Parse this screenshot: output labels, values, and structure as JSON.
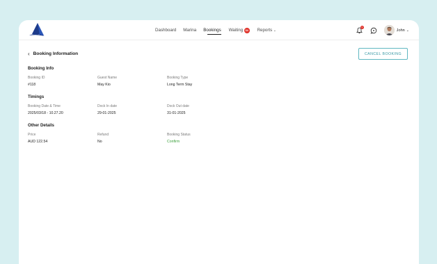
{
  "nav": {
    "items": [
      {
        "label": "Dashboard"
      },
      {
        "label": "Marina"
      },
      {
        "label": "Bookings"
      },
      {
        "label": "Waiting",
        "badge": "34"
      },
      {
        "label": "Reports"
      }
    ]
  },
  "header": {
    "bell_badge": "1",
    "user_name": "John"
  },
  "page": {
    "title": "Booking Information",
    "cancel_button": "CANCEL BOOKING"
  },
  "booking_info": {
    "title": "Booking Info",
    "fields": [
      {
        "label": "Booking ID",
        "value": "#118"
      },
      {
        "label": "Guest Name",
        "value": "May Kio"
      },
      {
        "label": "Booking Type",
        "value": "Long Term Stay"
      }
    ]
  },
  "timings": {
    "title": "Timings",
    "fields": [
      {
        "label": "Booking Date & Time",
        "value": "2025/03/18 - 10.27.20"
      },
      {
        "label": "Dock In date",
        "value": "29-01-2025"
      },
      {
        "label": "Dock Out date",
        "value": "31-01-2025"
      }
    ]
  },
  "other_details": {
    "title": "Other Details",
    "fields": [
      {
        "label": "Price",
        "value": "AUD 122.54"
      },
      {
        "label": "Refund",
        "value": "No"
      },
      {
        "label": "Booking Status",
        "value": "Confirm",
        "status_color": "#3a9f3a"
      }
    ]
  },
  "colors": {
    "background": "#d7eff1",
    "accent": "#3a9aa6",
    "badge": "#e0332b",
    "logo": "#1d3b8a"
  }
}
